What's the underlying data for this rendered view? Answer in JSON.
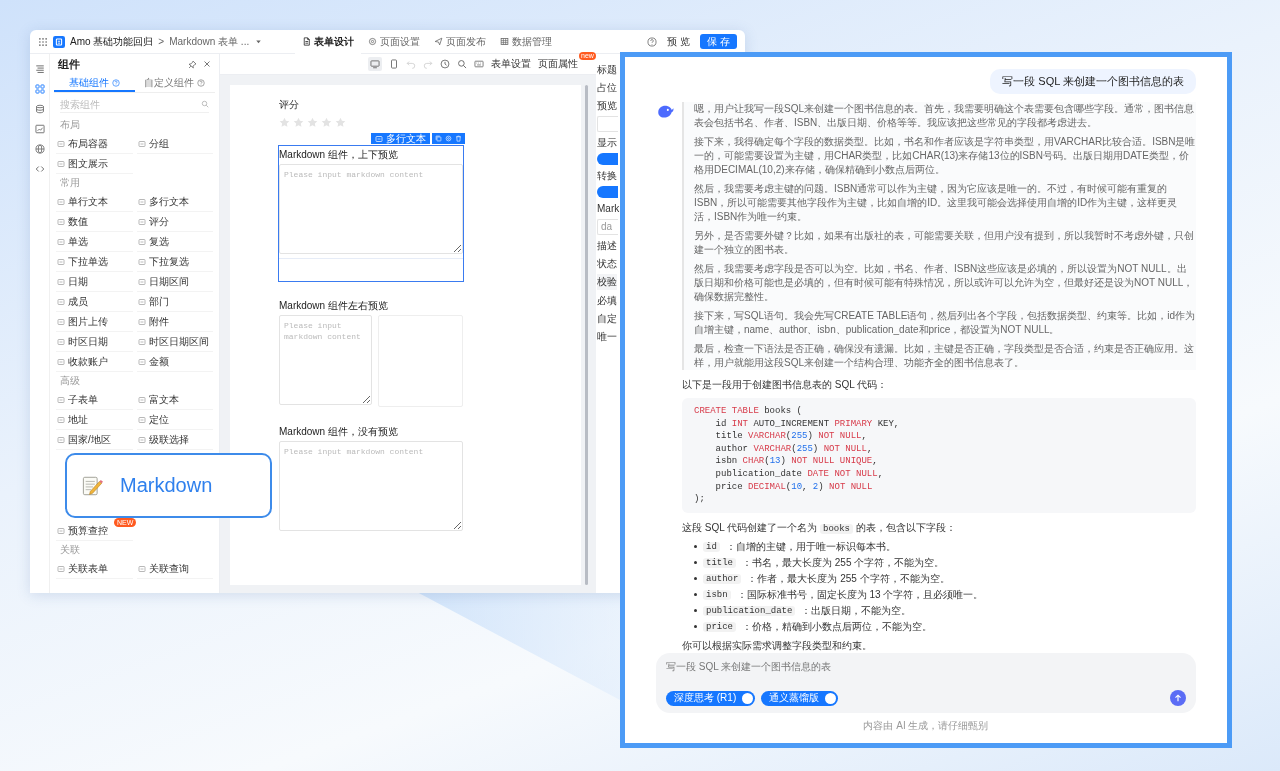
{
  "builder": {
    "topbar": {
      "app_name": "Amo 基础功能回归",
      "separator": ">",
      "form_name": "Markdown 表单 ...",
      "tabs": [
        {
          "label": "表单设计",
          "selected": true
        },
        {
          "label": "页面设置",
          "selected": false
        },
        {
          "label": "页面发布",
          "selected": false
        },
        {
          "label": "数据管理",
          "selected": false
        }
      ],
      "preview_button": "预 览",
      "save_button": "保 存"
    },
    "palette": {
      "title": "组件",
      "tabs": [
        {
          "label": "基础组件",
          "selected": true
        },
        {
          "label": "自定义组件",
          "selected": false
        }
      ],
      "search": {
        "placeholder": "搜索组件"
      },
      "sections": [
        {
          "title": "布局",
          "items": [
            {
              "label": "布局容器"
            },
            {
              "label": "分组"
            },
            {
              "label": "图文展示"
            }
          ]
        },
        {
          "title": "常用",
          "items": [
            {
              "label": "单行文本"
            },
            {
              "label": "多行文本"
            },
            {
              "label": "数值"
            },
            {
              "label": "评分"
            },
            {
              "label": "单选"
            },
            {
              "label": "复选"
            },
            {
              "label": "下拉单选"
            },
            {
              "label": "下拉复选"
            },
            {
              "label": "日期"
            },
            {
              "label": "日期区间"
            },
            {
              "label": "成员"
            },
            {
              "label": "部门"
            },
            {
              "label": "图片上传"
            },
            {
              "label": "附件"
            },
            {
              "label": "时区日期"
            },
            {
              "label": "时区日期区间"
            },
            {
              "label": "收款账户"
            },
            {
              "label": "金额"
            }
          ]
        },
        {
          "title": "高级",
          "items": [
            {
              "label": "子表单"
            },
            {
              "label": "富文本"
            },
            {
              "label": "地址"
            },
            {
              "label": "定位"
            },
            {
              "label": "国家/地区"
            },
            {
              "label": "级联选择"
            },
            {
              "label": "预算查控",
              "badge": "NEW"
            }
          ]
        },
        {
          "title": "关联",
          "items": [
            {
              "label": "关联表单"
            },
            {
              "label": "关联查询"
            }
          ]
        }
      ]
    },
    "toolbar": {
      "links": [
        {
          "label": "表单设置"
        },
        {
          "label": "页面属性",
          "badge": "new"
        }
      ]
    },
    "form": {
      "fields": [
        {
          "kind": "rating",
          "label": "评分",
          "stars": 0,
          "selected": false
        },
        {
          "kind": "markdown_stacked",
          "label": "Markdown 组件，上下预览",
          "placeholder": "Please input markdown content",
          "selected": true,
          "type_tag": "多行文本"
        },
        {
          "kind": "markdown_side",
          "label": "Markdown 组件左右预览",
          "placeholder": "Please input markdown content",
          "selected": false
        },
        {
          "kind": "markdown_plain",
          "label": "Markdown 组件，没有预览",
          "placeholder": "Please input markdown content",
          "selected": false
        }
      ]
    },
    "properties": [
      {
        "kind": "label",
        "text": "标题"
      },
      {
        "kind": "label",
        "text": "占位"
      },
      {
        "kind": "label",
        "text": "预览"
      },
      {
        "kind": "field"
      },
      {
        "kind": "label",
        "text": "显示"
      },
      {
        "kind": "switch",
        "on": true
      },
      {
        "kind": "label",
        "text": "转换"
      },
      {
        "kind": "switch",
        "on": true
      },
      {
        "kind": "label",
        "text": "Mark"
      },
      {
        "kind": "field",
        "text": "da"
      },
      {
        "kind": "label",
        "text": "描述"
      },
      {
        "kind": "label",
        "text": "状态"
      },
      {
        "kind": "section",
        "text": "校验"
      },
      {
        "kind": "label",
        "text": "必填"
      },
      {
        "kind": "label",
        "text": "自定"
      },
      {
        "kind": "label",
        "text": "唯一"
      }
    ]
  },
  "callout": {
    "label": "Markdown"
  },
  "chat": {
    "user_message": "写一段 SQL 来创建一个图书信息的表",
    "thinking": [
      "嗯，用户让我写一段SQL来创建一个图书信息的表。首先，我需要明确这个表需要包含哪些字段。通常，图书信息表会包括书名、作者、ISBN、出版日期、价格等等。我应该把这些常见的字段都考虑进去。",
      "接下来，我得确定每个字段的数据类型。比如，书名和作者应该是字符串类型，用VARCHAR比较合适。ISBN是唯一的，可能需要设置为主键，用CHAR类型，比如CHAR(13)来存储13位的ISBN号码。出版日期用DATE类型，价格用DECIMAL(10,2)来存储，确保精确到小数点后两位。",
      "然后，我需要考虑主键的问题。ISBN通常可以作为主键，因为它应该是唯一的。不过，有时候可能有重复的ISBN，所以可能需要其他字段作为主键，比如自增的ID。这里我可能会选择使用自增的ID作为主键，这样更灵活，ISBN作为唯一约束。",
      "另外，是否需要外键？比如，如果有出版社的表，可能需要关联，但用户没有提到，所以我暂时不考虑外键，只创建一个独立的图书表。",
      "然后，我需要考虑字段是否可以为空。比如，书名、作者、ISBN这些应该是必填的，所以设置为NOT NULL。出版日期和价格可能也是必填的，但有时候可能有特殊情况，所以或许可以允许为空，但最好还是设为NOT NULL，确保数据完整性。",
      "接下来，写SQL语句。我会先写CREATE TABLE语句，然后列出各个字段，包括数据类型、约束等。比如，id作为自增主键，name、author、isbn、publication_date和price，都设置为NOT NULL。",
      "最后，检查一下语法是否正确，确保没有遗漏。比如，主键是否正确，字段类型是否合适，约束是否正确应用。这样，用户就能用这段SQL来创建一个结构合理、功能齐全的图书信息表了。"
    ],
    "intro": "以下是一段用于创建图书信息表的 SQL 代码：",
    "code": [
      [
        {
          "text": "CREATE TABLE",
          "kind": "keyword"
        },
        {
          "text": " books (",
          "kind": "plain"
        }
      ],
      [
        {
          "text": "    id ",
          "kind": "plain"
        },
        {
          "text": "INT",
          "kind": "keyword"
        },
        {
          "text": " AUTO_INCREMENT ",
          "kind": "plain"
        },
        {
          "text": "PRIMARY",
          "kind": "keyword"
        },
        {
          "text": " KEY,",
          "kind": "plain"
        }
      ],
      [
        {
          "text": "    title ",
          "kind": "plain"
        },
        {
          "text": "VARCHAR",
          "kind": "keyword"
        },
        {
          "text": "(",
          "kind": "plain"
        },
        {
          "text": "255",
          "kind": "number"
        },
        {
          "text": ") ",
          "kind": "plain"
        },
        {
          "text": "NOT NULL",
          "kind": "keyword"
        },
        {
          "text": ",",
          "kind": "plain"
        }
      ],
      [
        {
          "text": "    author ",
          "kind": "plain"
        },
        {
          "text": "VARCHAR",
          "kind": "keyword"
        },
        {
          "text": "(",
          "kind": "plain"
        },
        {
          "text": "255",
          "kind": "number"
        },
        {
          "text": ") ",
          "kind": "plain"
        },
        {
          "text": "NOT NULL",
          "kind": "keyword"
        },
        {
          "text": ",",
          "kind": "plain"
        }
      ],
      [
        {
          "text": "    isbn ",
          "kind": "plain"
        },
        {
          "text": "CHAR",
          "kind": "keyword"
        },
        {
          "text": "(",
          "kind": "plain"
        },
        {
          "text": "13",
          "kind": "number"
        },
        {
          "text": ") ",
          "kind": "plain"
        },
        {
          "text": "NOT NULL UNIQUE",
          "kind": "keyword"
        },
        {
          "text": ",",
          "kind": "plain"
        }
      ],
      [
        {
          "text": "    publication_date ",
          "kind": "plain"
        },
        {
          "text": "DATE NOT NULL",
          "kind": "keyword"
        },
        {
          "text": ",",
          "kind": "plain"
        }
      ],
      [
        {
          "text": "    price ",
          "kind": "plain"
        },
        {
          "text": "DECIMAL",
          "kind": "keyword"
        },
        {
          "text": "(",
          "kind": "plain"
        },
        {
          "text": "10",
          "kind": "number"
        },
        {
          "text": ", ",
          "kind": "plain"
        },
        {
          "text": "2",
          "kind": "number"
        },
        {
          "text": ") ",
          "kind": "plain"
        },
        {
          "text": "NOT NULL",
          "kind": "keyword"
        }
      ],
      [
        {
          "text": ");",
          "kind": "plain"
        }
      ]
    ],
    "summary": {
      "before": "这段 SQL 代码创建了一个名为 ",
      "code": "books",
      "after": " 的表，包含以下字段："
    },
    "fields": [
      {
        "code": "id",
        "text": "：自增的主键，用于唯一标识每本书。"
      },
      {
        "code": "title",
        "text": "：书名，最大长度为 255 个字符，不能为空。"
      },
      {
        "code": "author",
        "text": "：作者，最大长度为 255 个字符，不能为空。"
      },
      {
        "code": "isbn",
        "text": "：国际标准书号，固定长度为 13 个字符，且必须唯一。"
      },
      {
        "code": "publication_date",
        "text": "：出版日期，不能为空。"
      },
      {
        "code": "price",
        "text": "：价格，精确到小数点后两位，不能为空。"
      }
    ],
    "closing": "你可以根据实际需求调整字段类型和约束。",
    "input": {
      "placeholder": "写一段 SQL 来创建一个图书信息的表"
    },
    "toggles": [
      {
        "label": "深度思考 (R1)",
        "on": true
      },
      {
        "label": "通义蒸馏版",
        "on": true
      }
    ],
    "disclaimer": "内容由 AI 生成，请仔细甄别"
  }
}
